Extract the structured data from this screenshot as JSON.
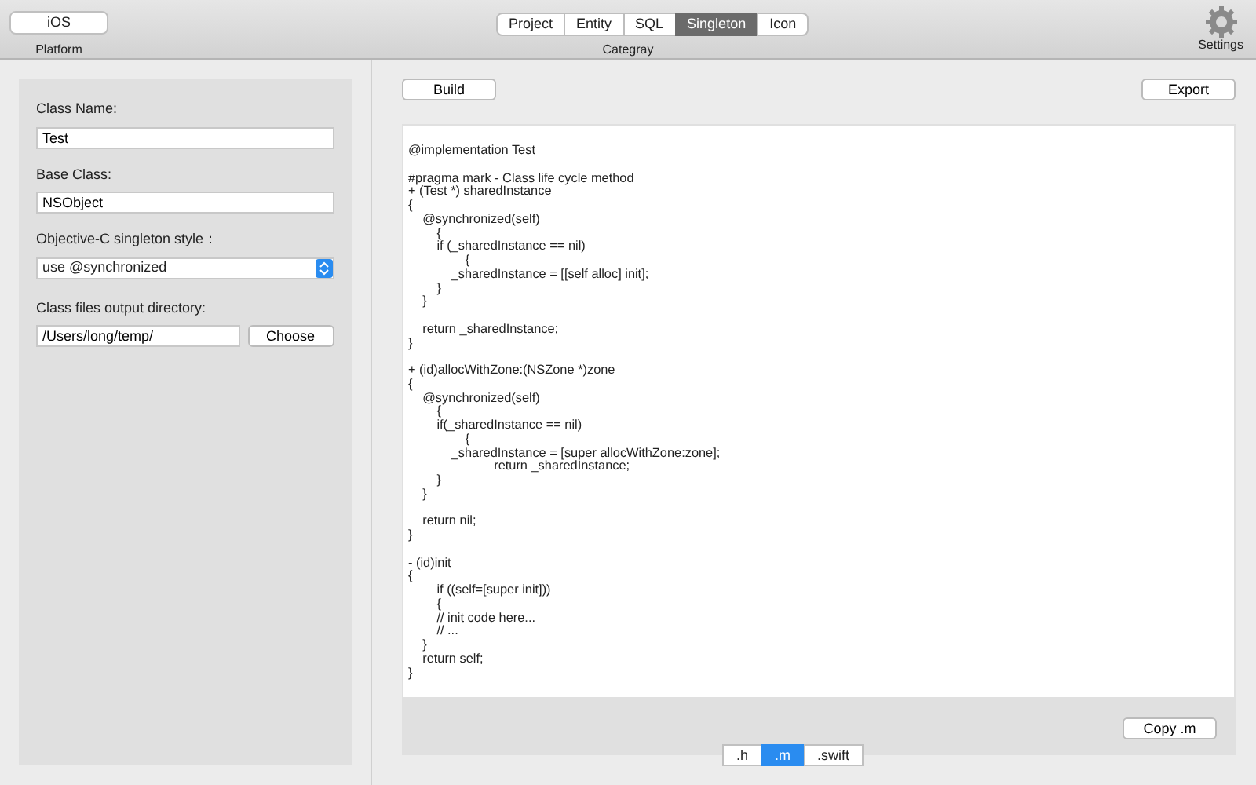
{
  "toolbar": {
    "platform": {
      "value": "iOS",
      "label": "Platform"
    },
    "categories": [
      {
        "label": "Project",
        "selected": false
      },
      {
        "label": "Entity",
        "selected": false
      },
      {
        "label": "SQL",
        "selected": false
      },
      {
        "label": "Singleton",
        "selected": true
      },
      {
        "label": "Icon",
        "selected": false
      }
    ],
    "category_label": "Categray",
    "settings_label": "Settings"
  },
  "form": {
    "class_name_label": "Class Name:",
    "class_name": "Test",
    "base_class_label": "Base Class:",
    "base_class": "NSObject",
    "style_label": "Objective-C singleton style：",
    "style_value": "use @synchronized",
    "dir_label": "Class files output directory:",
    "dir_value": "/Users/long/temp/",
    "choose_button": "Choose"
  },
  "build_button": "Build",
  "export_button": "Export",
  "code": "@implementation Test\n\n#pragma mark - Class life cycle method\n+ (Test *) sharedInstance\n{\n    @synchronized(self)\n        {\n        if (_sharedInstance == nil)\n                {\n            _sharedInstance = [[self alloc] init];\n        }\n    }\n\n    return _sharedInstance;\n}\n\n+ (id)allocWithZone:(NSZone *)zone\n{\n    @synchronized(self)\n        {\n        if(_sharedInstance == nil)\n                {\n            _sharedInstance = [super allocWithZone:zone];\n                        return _sharedInstance;\n        }\n    }\n\n    return nil;\n}\n\n- (id)init\n{\n        if ((self=[super init]))\n        {\n        // init code here...\n        // ...\n    }\n    return self;\n}",
  "copy_button": "Copy .m",
  "file_tabs": [
    {
      "label": ".h",
      "selected": false
    },
    {
      "label": ".m",
      "selected": true
    },
    {
      "label": ".swift",
      "selected": false
    }
  ]
}
